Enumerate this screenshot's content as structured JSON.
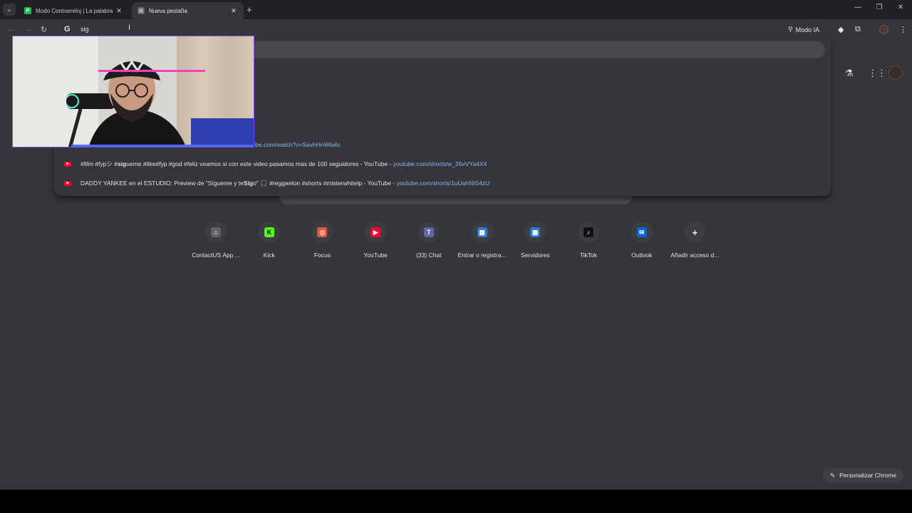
{
  "tabs": [
    {
      "title": "Modo Contrarreloj | La palabra",
      "favicon": "P"
    },
    {
      "title": "Nueva pestaña"
    }
  ],
  "toolbar": {
    "omnibox_text": "sig",
    "modo_ia_label": "Modo IA"
  },
  "dropdown": {
    "partial_url": "be.com/watch?v=SavhHnWla6c",
    "suggestions": [
      {
        "pre": "#film #fypシ #",
        "bold": "sig",
        "post": "ueme #like#fyp #god #feliz veamos si con este video pasamos mas de 100 seguidores - YouTube",
        "url": "youtube.com/shorts/w_26vVYa4X4"
      },
      {
        "pre": "DADDY YANKEE en el ESTUDIO: Preview de \"Sígueme y te ",
        "bold": "Sig",
        "post": "o\" 🎧 #reggaeton #shorts #misterwhitelp - YouTube",
        "url": "youtube.com/shorts/1uUahNIS4zU"
      }
    ]
  },
  "shortcuts": [
    {
      "label": "ContactUS App ...",
      "icon": "contactus-icon",
      "color": "#5f6368",
      "glyph": "⌂"
    },
    {
      "label": "Kick",
      "icon": "kick-icon",
      "color": "#53fc18",
      "glyph": "K"
    },
    {
      "label": "Focus",
      "icon": "focus-icon",
      "color": "#e8553f",
      "glyph": "◎"
    },
    {
      "label": "YouTube",
      "icon": "youtube-icon",
      "color": "#ff0033",
      "glyph": "▶"
    },
    {
      "label": "(33) Chat",
      "icon": "teams-icon",
      "color": "#6264a7",
      "glyph": "T"
    },
    {
      "label": "Entrar o registra...",
      "icon": "grid-icon",
      "color": "#2b7cd3",
      "glyph": "▦"
    },
    {
      "label": "Servidores",
      "icon": "grid-icon",
      "color": "#2b7cd3",
      "glyph": "▦"
    },
    {
      "label": "TikTok",
      "icon": "tiktok-icon",
      "color": "#111111",
      "glyph": "♪"
    },
    {
      "label": "Outlook",
      "icon": "outlook-icon",
      "color": "#0a64d8",
      "glyph": "✉"
    },
    {
      "label": "Añadir acceso d...",
      "icon": "add-icon",
      "color": "#3c3d41",
      "glyph": "+"
    }
  ],
  "customize_label": "Personalizar Chrome",
  "colors": {
    "background": "#35363a",
    "tabstrip": "#202124",
    "link": "#8ab4f8",
    "accent_pink": "#ff3dbf"
  }
}
